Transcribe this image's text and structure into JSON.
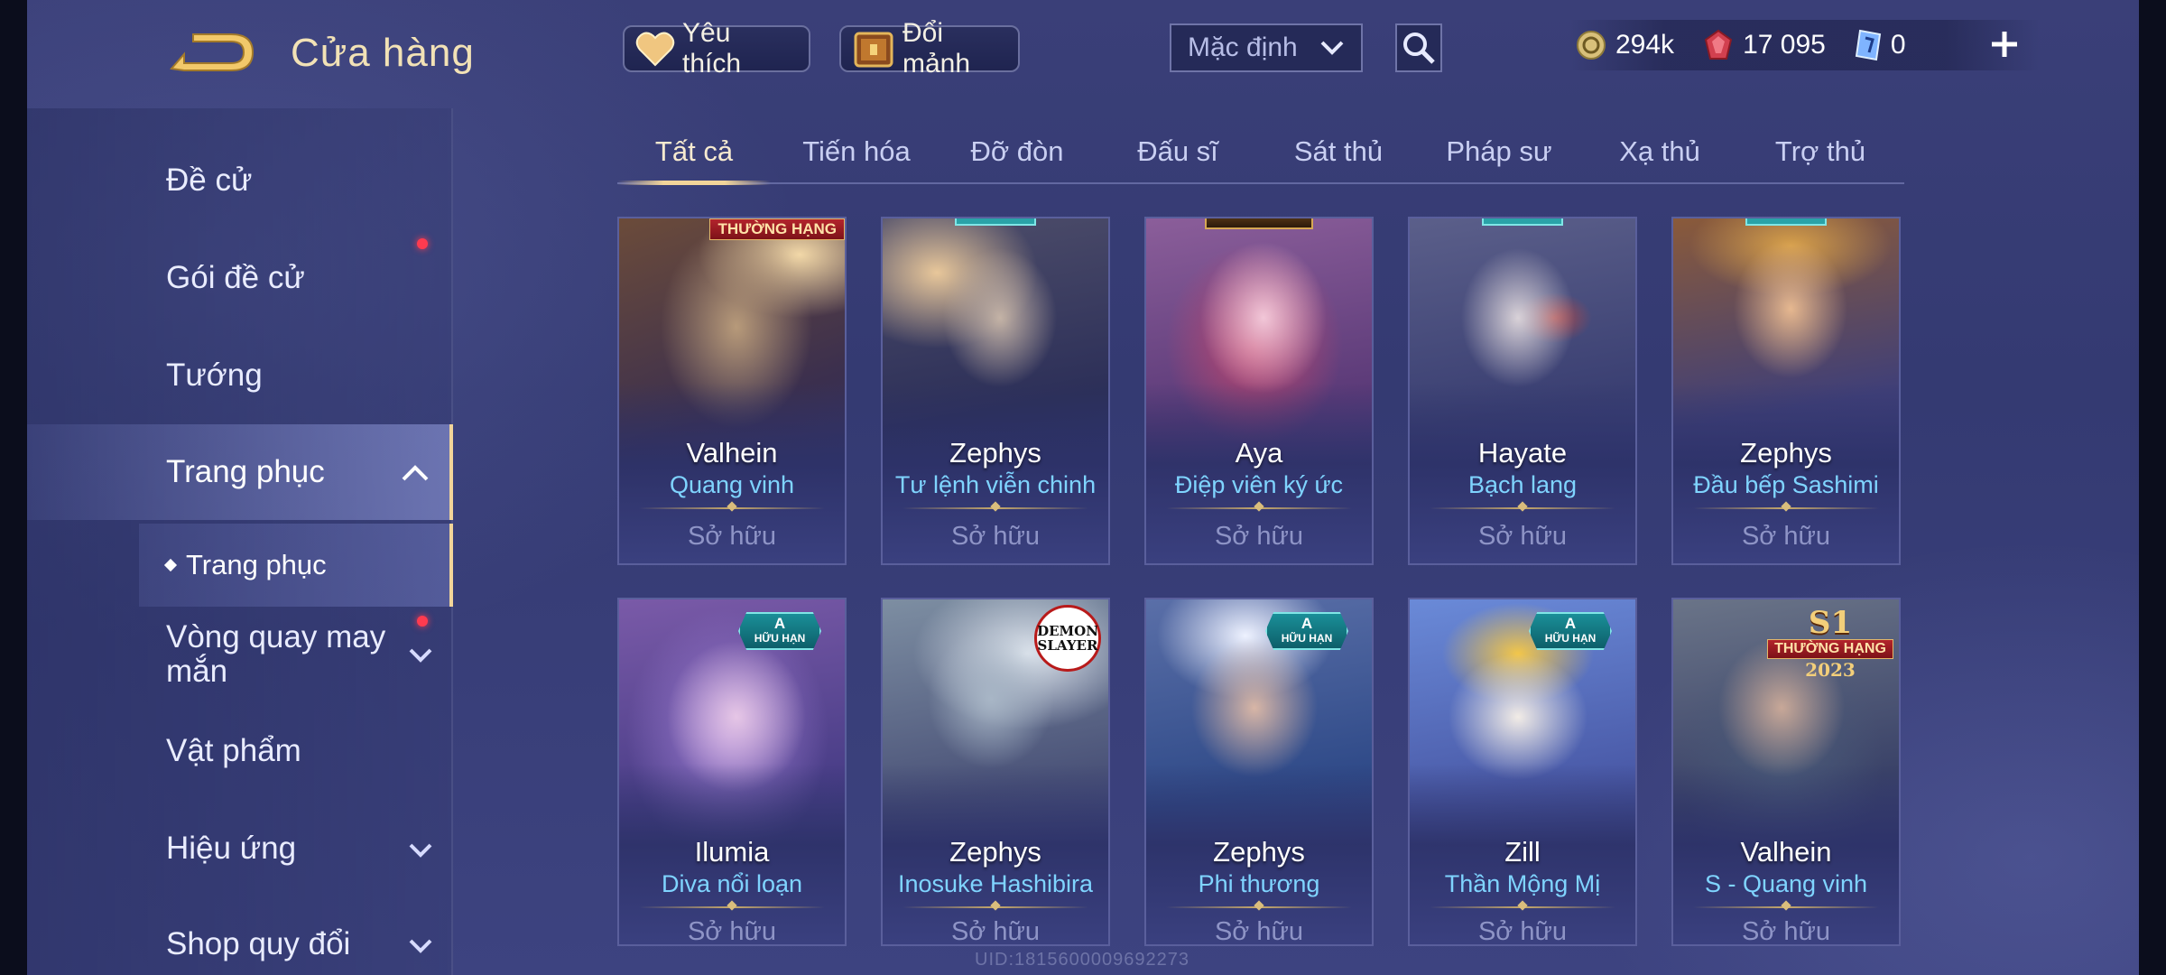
{
  "header": {
    "title": "Cửa hàng",
    "favorite_label": "Yêu thích",
    "exchange_label": "Đổi mảnh",
    "sort_value": "Mặc định"
  },
  "currency": {
    "gold": "294k",
    "vouchers": "17 095",
    "tickets": "0"
  },
  "sidebar": {
    "items": [
      {
        "label": "Đề cử"
      },
      {
        "label": "Gói đề cử",
        "has_dot": true
      },
      {
        "label": "Tướng"
      },
      {
        "label": "Trang phục",
        "expanded": true,
        "active": true
      },
      {
        "label": "Vòng quay may mắn",
        "has_dot": true
      },
      {
        "label": "Vật phẩm"
      },
      {
        "label": "Hiệu ứng"
      },
      {
        "label": "Shop quy đổi"
      }
    ],
    "sub_item": "Trang phục"
  },
  "tabs": [
    {
      "label": "Tất cả",
      "active": true
    },
    {
      "label": "Tiến hóa"
    },
    {
      "label": "Đỡ đòn"
    },
    {
      "label": "Đấu sĩ"
    },
    {
      "label": "Sát thủ"
    },
    {
      "label": "Pháp sư"
    },
    {
      "label": "Xạ thủ"
    },
    {
      "label": "Trợ thủ"
    }
  ],
  "cards": [
    {
      "hero": "Valhein",
      "skin": "Quang vinh",
      "status": "Sở hữu",
      "badge": "THƯỜNG HẠNG"
    },
    {
      "hero": "Zephys",
      "skin": "Tư lệnh viễn chinh",
      "status": "Sở hữu"
    },
    {
      "hero": "Aya",
      "skin": "Điệp viên ký ức",
      "status": "Sở hữu"
    },
    {
      "hero": "Hayate",
      "skin": "Bạch lang",
      "status": "Sở hữu"
    },
    {
      "hero": "Zephys",
      "skin": "Đầu bếp Sashimi",
      "status": "Sở hữu"
    },
    {
      "hero": "Ilumia",
      "skin": "Diva nổi loạn",
      "status": "Sở hữu",
      "tier": "A",
      "tier_label": "HỮU HẠN"
    },
    {
      "hero": "Zephys",
      "skin": "Inosuke Hashibira",
      "status": "Sở hữu",
      "collab_top": "DEMON",
      "collab_bottom": "SLAYER"
    },
    {
      "hero": "Zephys",
      "skin": "Phi thương",
      "status": "Sở hữu",
      "tier": "A",
      "tier_label": "HỮU HẠN"
    },
    {
      "hero": "Zill",
      "skin": "Thần Mộng Mị",
      "status": "Sở hữu",
      "tier": "A",
      "tier_label": "HỮU HẠN"
    },
    {
      "hero": "Valhein",
      "skin": "S - Quang vinh",
      "status": "Sở hữu",
      "season": "S1",
      "rank": "THƯỜNG HẠNG",
      "year": "2023"
    }
  ],
  "footer_id": "UID:1815600009692273",
  "colors": {
    "accent_gold": "#f2d59a",
    "skin_name": "#7fd4ff",
    "notify_dot": "#ff3b4f"
  }
}
